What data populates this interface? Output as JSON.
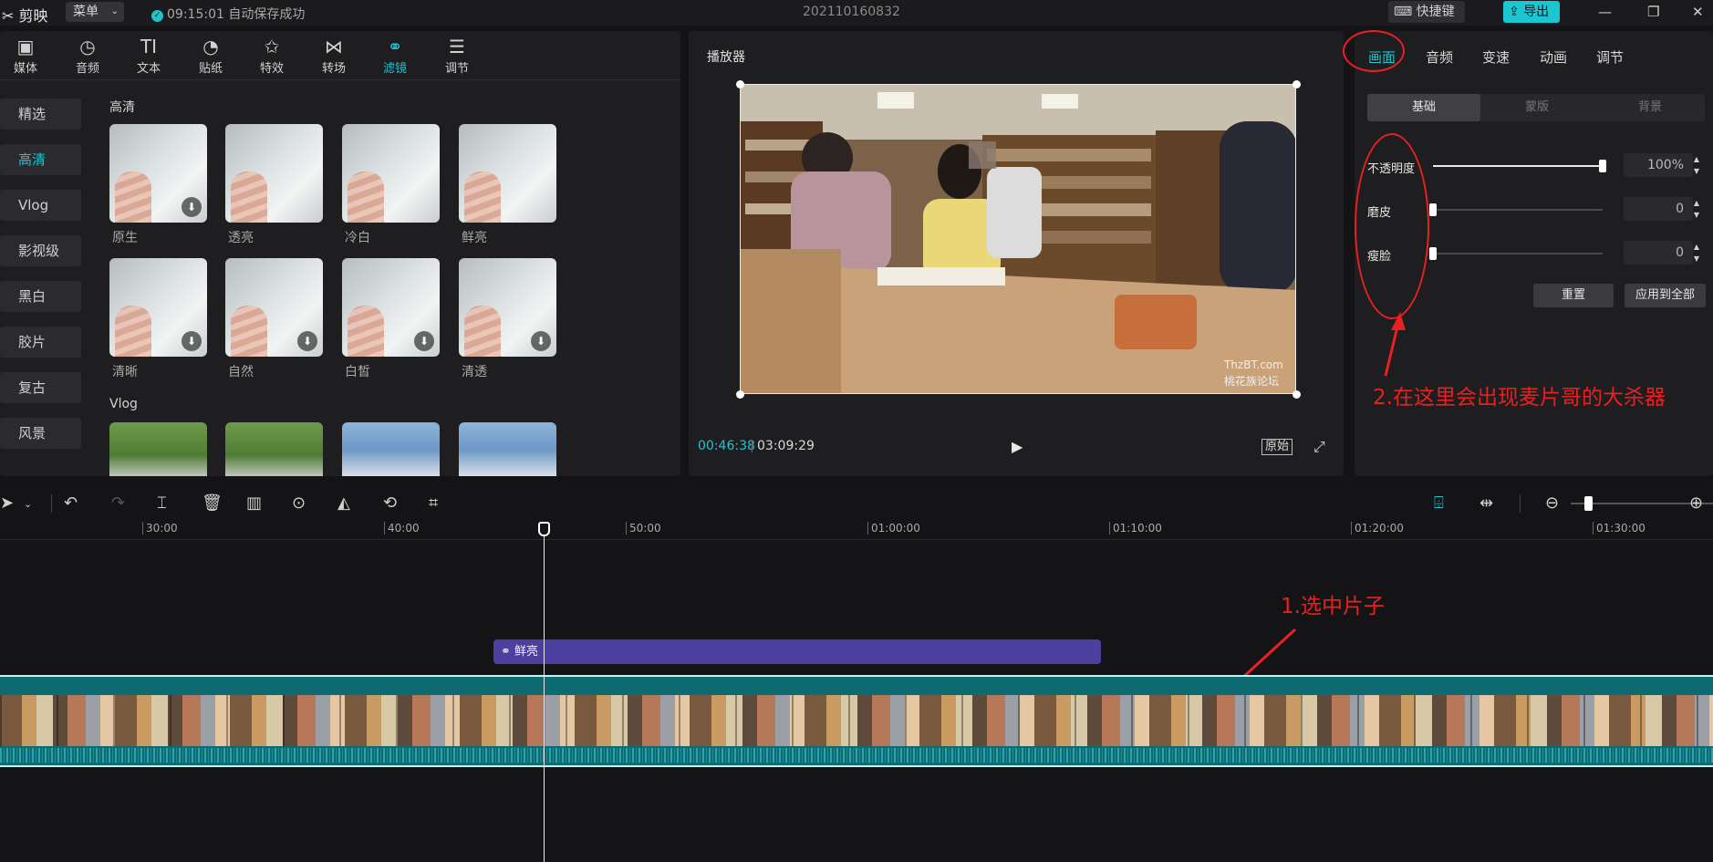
{
  "titlebar": {
    "app_name": "剪映",
    "menu_label": "菜单",
    "save_status": "09:15:01 自动保存成功",
    "project_title": "202110160832",
    "shortcut_label": "快捷键",
    "export_label": "导出"
  },
  "toolbar": {
    "tabs": [
      {
        "label": "媒体",
        "icon": "media-icon"
      },
      {
        "label": "音频",
        "icon": "audio-icon"
      },
      {
        "label": "文本",
        "icon": "text-icon",
        "glyph": "TI"
      },
      {
        "label": "贴纸",
        "icon": "sticker-icon"
      },
      {
        "label": "特效",
        "icon": "effects-icon"
      },
      {
        "label": "转场",
        "icon": "transition-icon"
      },
      {
        "label": "滤镜",
        "icon": "filter-icon"
      },
      {
        "label": "调节",
        "icon": "adjust-icon"
      }
    ],
    "active": "滤镜"
  },
  "categories": [
    "精选",
    "高清",
    "Vlog",
    "影视级",
    "黑白",
    "胶片",
    "复古",
    "风景"
  ],
  "active_category": "高清",
  "filters": {
    "section_hd": "高清",
    "hd_items": [
      "原生",
      "透亮",
      "冷白",
      "鲜亮",
      "清晰",
      "自然",
      "白皙",
      "清透"
    ],
    "section_vlog": "Vlog"
  },
  "player": {
    "title": "播放器",
    "current_time": "00:46:38",
    "total_time": "03:09:29",
    "original_label": "原始",
    "watermark_1": "ThzBT.com",
    "watermark_2": "桃花族论坛"
  },
  "inspector": {
    "tabs": [
      "画面",
      "音频",
      "变速",
      "动画",
      "调节"
    ],
    "active_tab": "画面",
    "segments": [
      "基础",
      "蒙版",
      "背景"
    ],
    "active_segment": "基础",
    "props": [
      {
        "label": "不透明度",
        "value": "100%",
        "level": 1.0
      },
      {
        "label": "磨皮",
        "value": "0",
        "level": 0.0
      },
      {
        "label": "瘦脸",
        "value": "0",
        "level": 0.0
      }
    ],
    "reset_label": "重置",
    "apply_all_label": "应用到全部"
  },
  "annotations": {
    "note_2": "2.在这里会出现麦片哥的大杀器",
    "note_1": "1.选中片子"
  },
  "timeline": {
    "ruler_labels": [
      "30:00",
      "40:00",
      "50:00",
      "01:00:00",
      "01:10:00",
      "01:20:00",
      "01:30:00"
    ],
    "filter_clip_label": "鲜亮",
    "zoom_level": 0.1
  },
  "colors": {
    "accent": "#1ac6d2",
    "annotation": "#e82020",
    "filter_clip": "#4d3fa0"
  }
}
